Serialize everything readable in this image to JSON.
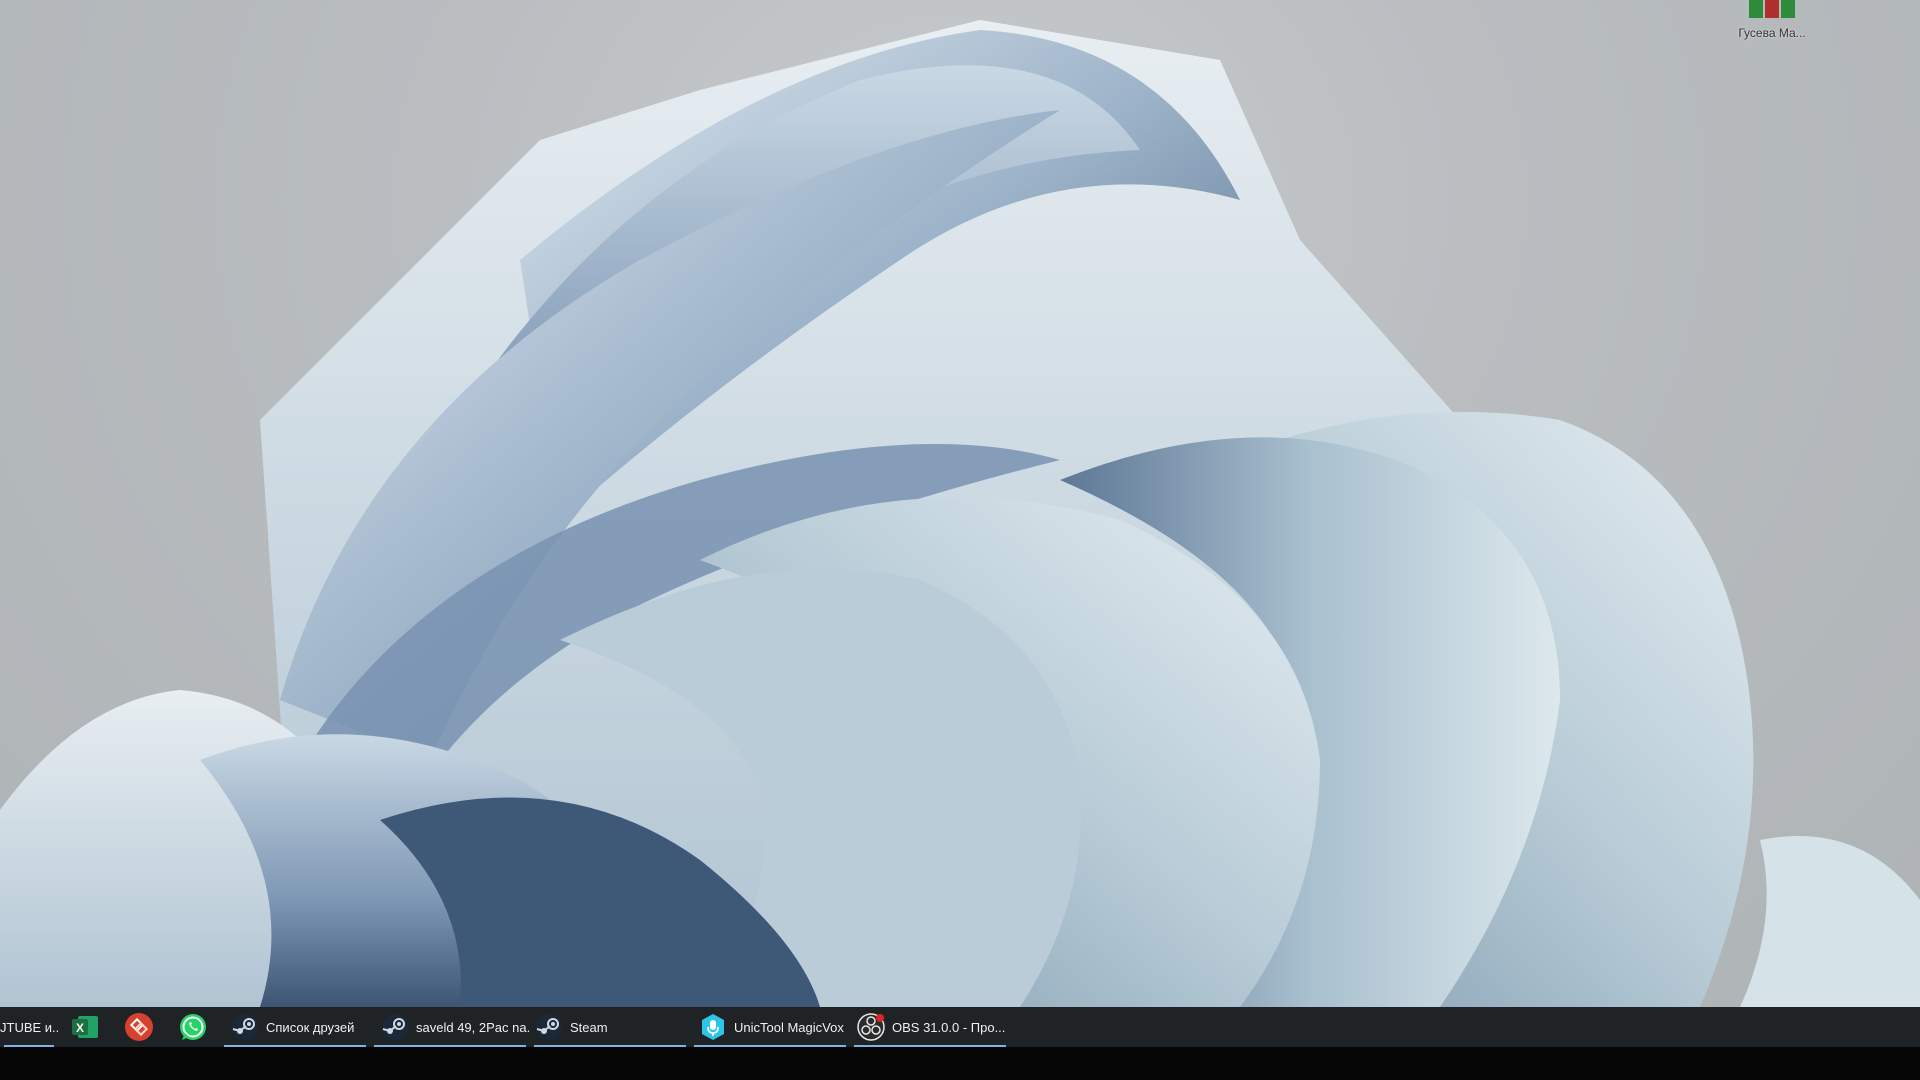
{
  "desktop": {
    "icon_label": "Гусева Ма...",
    "icon_name": "winrar-archive-icon"
  },
  "taskbar": {
    "items": [
      {
        "label": "JTUBE и...",
        "icon": "app-window-icon",
        "active": true
      },
      {
        "label": "",
        "icon": "excel-icon",
        "active": false
      },
      {
        "label": "",
        "icon": "anydesk-remote-icon",
        "active": false
      },
      {
        "label": "",
        "icon": "whatsapp-icon",
        "active": false
      },
      {
        "label": "Список друзей",
        "icon": "steam-icon",
        "active": true
      },
      {
        "label": "saveld 49, 2Pac na...",
        "icon": "steam-icon",
        "active": true
      },
      {
        "label": "Steam",
        "icon": "steam-icon",
        "active": true
      },
      {
        "label": "UnicTool MagicVox",
        "icon": "magicvox-icon",
        "active": true
      },
      {
        "label": "OBS 31.0.0 - Про...",
        "icon": "obs-icon",
        "active": true
      }
    ]
  },
  "colors": {
    "taskbar_bg": "#202325",
    "active_indicator": "#7fb2e8",
    "excel_green": "#1d6f42",
    "whatsapp_green": "#25d366",
    "anydesk_red": "#d8412f",
    "steam_blue": "#1b2838",
    "magicvox_cyan": "#2ec4e8"
  }
}
